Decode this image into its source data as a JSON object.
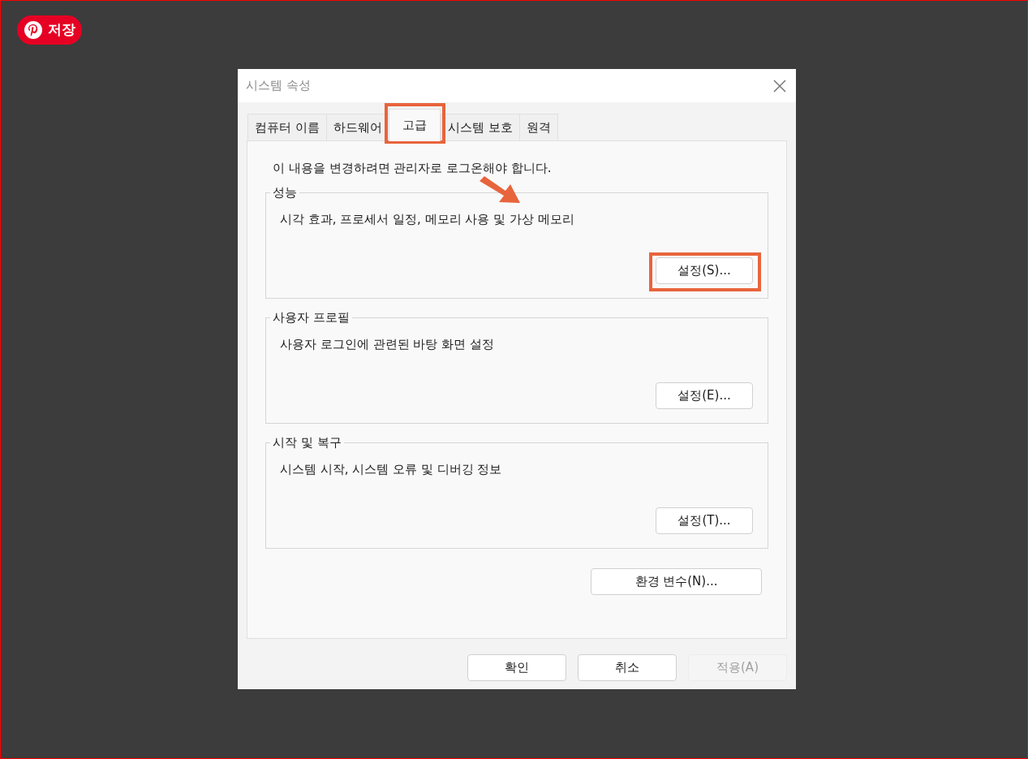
{
  "save_badge": {
    "label": "저장"
  },
  "window": {
    "title": "시스템 속성"
  },
  "tabs": [
    {
      "label": "컴퓨터 이름",
      "selected": false
    },
    {
      "label": "하드웨어",
      "selected": false
    },
    {
      "label": "고급",
      "selected": true
    },
    {
      "label": "시스템 보호",
      "selected": false
    },
    {
      "label": "원격",
      "selected": false
    }
  ],
  "notice": "이 내용을 변경하려면 관리자로 로그온해야 합니다.",
  "groups": [
    {
      "title": "성능",
      "description": "시각 효과, 프로세서 일정, 메모리 사용 및 가상 메모리",
      "button": {
        "label": "설정(S)..."
      }
    },
    {
      "title": "사용자 프로필",
      "description": "사용자 로그인에 관련된 바탕 화면 설정",
      "button": {
        "label": "설정(E)..."
      }
    },
    {
      "title": "시작 및 복구",
      "description": "시스템 시작, 시스템 오류 및 디버깅 정보",
      "button": {
        "label": "설정(T)..."
      }
    }
  ],
  "env_button": {
    "label": "환경 변수(N)..."
  },
  "footer_buttons": [
    {
      "label": "확인",
      "disabled": false
    },
    {
      "label": "취소",
      "disabled": false
    },
    {
      "label": "적용(A)",
      "disabled": true
    }
  ]
}
